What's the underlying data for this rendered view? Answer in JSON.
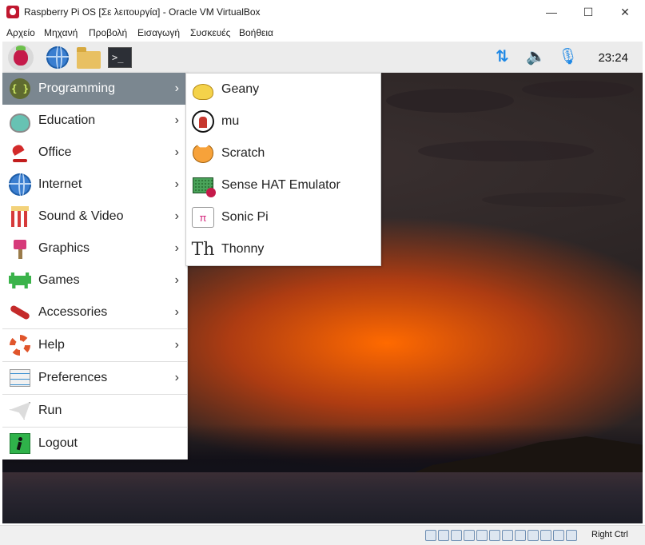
{
  "window": {
    "title": "Raspberry Pi OS [Σε λειτουργία] - Oracle VM VirtualBox",
    "minimize_glyph": "—",
    "maximize_glyph": "☐",
    "close_glyph": "✕"
  },
  "menubar": [
    "Αρχείο",
    "Μηχανή",
    "Προβολή",
    "Εισαγωγή",
    "Συσκευές",
    "Βοήθεια"
  ],
  "taskbar": {
    "clock": "23:24",
    "terminal_prompt": ">_",
    "network_glyph": "⇅",
    "volume_glyph": "🔈",
    "mic_glyph": "🎙"
  },
  "main_menu": [
    {
      "label": "Programming",
      "arrow": "›",
      "selected": true
    },
    {
      "label": "Education",
      "arrow": "›"
    },
    {
      "label": "Office",
      "arrow": "›"
    },
    {
      "label": "Internet",
      "arrow": "›"
    },
    {
      "label": "Sound & Video",
      "arrow": "›"
    },
    {
      "label": "Graphics",
      "arrow": "›"
    },
    {
      "label": "Games",
      "arrow": "›"
    },
    {
      "label": "Accessories",
      "arrow": "›"
    },
    {
      "label": "Help",
      "arrow": "›"
    },
    {
      "label": "Preferences",
      "arrow": "›"
    },
    {
      "label": "Run"
    },
    {
      "label": "Logout"
    }
  ],
  "programming_submenu": [
    {
      "label": "Geany"
    },
    {
      "label": "mu"
    },
    {
      "label": "Scratch"
    },
    {
      "label": "Sense HAT Emulator"
    },
    {
      "label": "Sonic Pi"
    },
    {
      "label": "Thonny"
    }
  ],
  "icons": {
    "programming": "{ }",
    "sonic_pi": "π",
    "thonny": "Th"
  },
  "statusbar": {
    "host_key": "Right Ctrl"
  },
  "colors": {
    "selected_row": "#7b8790",
    "tray_blue": "#1e88e5"
  }
}
